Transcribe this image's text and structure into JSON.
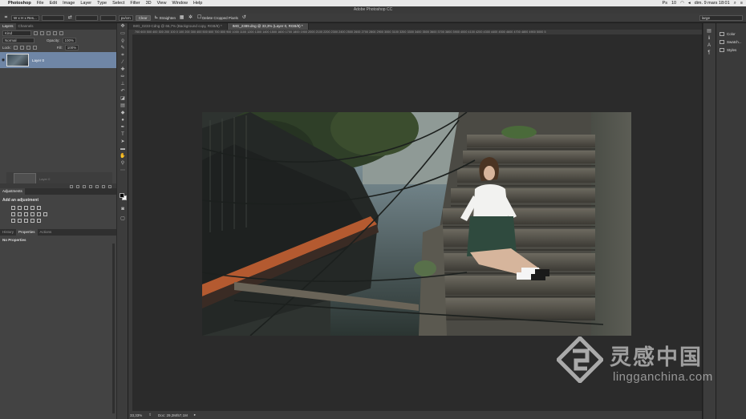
{
  "menubar": {
    "apple": "",
    "app": "Photoshop",
    "items": [
      "File",
      "Edit",
      "Image",
      "Layer",
      "Type",
      "Select",
      "Filter",
      "3D",
      "View",
      "Window",
      "Help"
    ],
    "status_battery": "10",
    "status_clock": "dim. 9 mars 18:01"
  },
  "title": "Adobe Photoshop CC",
  "options": {
    "ratio": "W x H x Res...",
    "unit": "px/cm",
    "clear": "Clear",
    "straighten": "Straighten",
    "delete_cropped": "Delete Cropped Pixels",
    "workspace": "large"
  },
  "layers_panel": {
    "tabs": [
      "Layers",
      "Channels"
    ],
    "filter_label": "Kind",
    "blend_mode": "Normal",
    "opacity_label": "Opacity:",
    "opacity_value": "100%",
    "lock_label": "Lock:",
    "fill_label": "Fill:",
    "fill_value": "100%",
    "layer_name": "Layer 0"
  },
  "adjustments": {
    "tab": "Adjustments",
    "title": "Add an adjustment"
  },
  "properties": {
    "tabs": [
      "History",
      "Properties",
      "Actions"
    ],
    "content": "No Properties"
  },
  "documents": {
    "tabs": [
      "IMG_0233-Cdng @ 66,7% (Background copy, RGB/8) *",
      "IMG_2389.dng @ 33,3% (Layer 0, RGB/8) *"
    ],
    "active_index": 1
  },
  "ruler_labels": "700 600 500 400 300 200 100 0 100 200 300 400 500 600 700 800 900 1000 1100 1200 1300 1400 1500 1600 1700 1800 1900 2000 2100 2200 2300 2400 2500 2600 2700 2800 2900 3000 3100 3200 3300 3400 3500 3600 3700 3800 3900 4000 4100 4200 4300 4400 4500 4600 4700 4800 4900 5000 5",
  "status": {
    "zoom": "33,33%",
    "doc": "Doc: 29,2M/57,1M"
  },
  "right_panel": {
    "items": [
      "Color",
      "Swatch...",
      "Styles"
    ]
  },
  "watermark": {
    "chinese": "灵感中国",
    "url": "lingganchina.com"
  },
  "colors": {
    "accent_layer": "#6f86a6",
    "brand_logo": "#ffffff"
  }
}
